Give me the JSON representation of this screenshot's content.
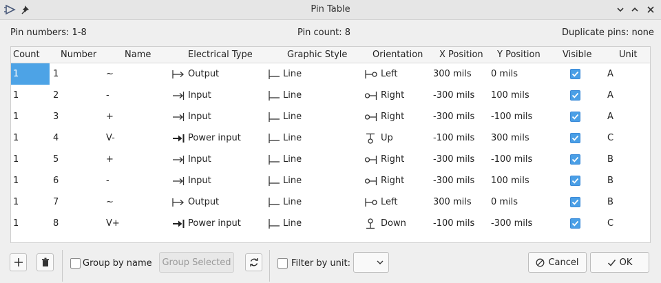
{
  "window": {
    "title": "Pin Table"
  },
  "info": {
    "pin_numbers": "Pin numbers:  1-8",
    "pin_count": "Pin count:  8",
    "duplicate_pins": "Duplicate pins:  none"
  },
  "columns": [
    "Count",
    "Number",
    "Name",
    "Electrical Type",
    "Graphic Style",
    "Orientation",
    "X Position",
    "Y Position",
    "Visible",
    "Unit"
  ],
  "rows": [
    {
      "count": "1",
      "number": "1",
      "name": "~",
      "etype": "Output",
      "etype_icon": "output-pin-icon",
      "gstyle": "Line",
      "orient": "Left",
      "orient_icon": "orientation-left-icon",
      "x": "300 mils",
      "y": "0 mils",
      "visible": true,
      "unit": "A"
    },
    {
      "count": "1",
      "number": "2",
      "name": "-",
      "etype": "Input",
      "etype_icon": "input-pin-icon",
      "gstyle": "Line",
      "orient": "Right",
      "orient_icon": "orientation-right-icon",
      "x": "-300 mils",
      "y": "100 mils",
      "visible": true,
      "unit": "A"
    },
    {
      "count": "1",
      "number": "3",
      "name": "+",
      "etype": "Input",
      "etype_icon": "input-pin-icon",
      "gstyle": "Line",
      "orient": "Right",
      "orient_icon": "orientation-right-icon",
      "x": "-300 mils",
      "y": "-100 mils",
      "visible": true,
      "unit": "A"
    },
    {
      "count": "1",
      "number": "4",
      "name": "V-",
      "etype": "Power input",
      "etype_icon": "power-input-pin-icon",
      "gstyle": "Line",
      "orient": "Up",
      "orient_icon": "orientation-up-icon",
      "x": "-100 mils",
      "y": "300 mils",
      "visible": true,
      "unit": "C"
    },
    {
      "count": "1",
      "number": "5",
      "name": "+",
      "etype": "Input",
      "etype_icon": "input-pin-icon",
      "gstyle": "Line",
      "orient": "Right",
      "orient_icon": "orientation-right-icon",
      "x": "-300 mils",
      "y": "-100 mils",
      "visible": true,
      "unit": "B"
    },
    {
      "count": "1",
      "number": "6",
      "name": "-",
      "etype": "Input",
      "etype_icon": "input-pin-icon",
      "gstyle": "Line",
      "orient": "Right",
      "orient_icon": "orientation-right-icon",
      "x": "-300 mils",
      "y": "100 mils",
      "visible": true,
      "unit": "B"
    },
    {
      "count": "1",
      "number": "7",
      "name": "~",
      "etype": "Output",
      "etype_icon": "output-pin-icon",
      "gstyle": "Line",
      "orient": "Left",
      "orient_icon": "orientation-left-icon",
      "x": "300 mils",
      "y": "0 mils",
      "visible": true,
      "unit": "B"
    },
    {
      "count": "1",
      "number": "8",
      "name": "V+",
      "etype": "Power input",
      "etype_icon": "power-input-pin-icon",
      "gstyle": "Line",
      "orient": "Down",
      "orient_icon": "orientation-down-icon",
      "x": "-100 mils",
      "y": "-300 mils",
      "visible": true,
      "unit": "C"
    }
  ],
  "footer": {
    "group_by_name": "Group by name",
    "group_selected": "Group Selected",
    "filter_by_unit": "Filter by unit:",
    "unit_filter_value": "",
    "cancel": "Cancel",
    "ok": "OK"
  },
  "colors": {
    "accent": "#4a9fe6",
    "selection": "#4da3e6"
  }
}
